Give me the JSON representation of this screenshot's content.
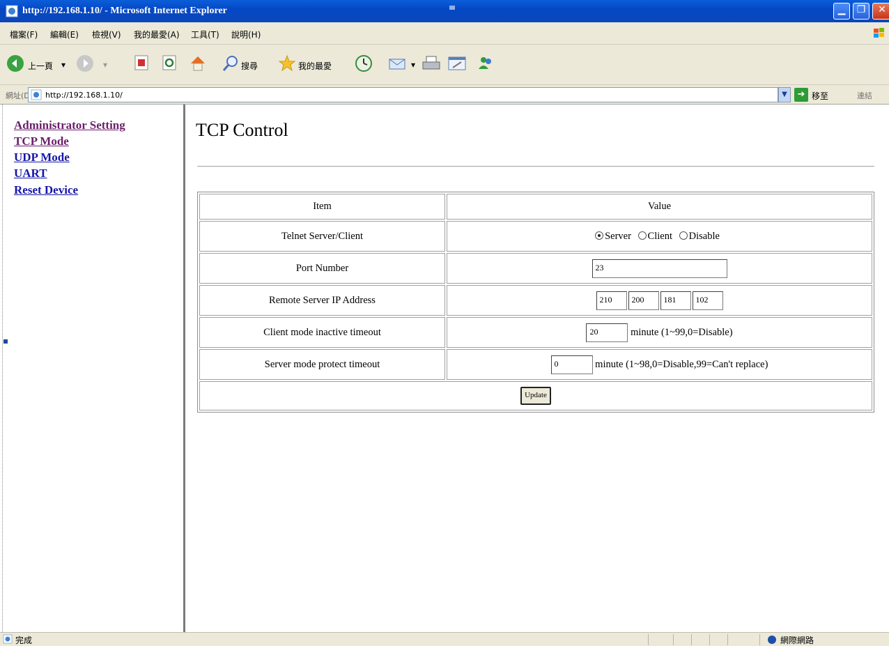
{
  "window": {
    "title": "http://192.168.1.10/ - Microsoft Internet Explorer"
  },
  "menubar": {
    "items": [
      "檔案(F)",
      "編輯(E)",
      "檢視(V)",
      "我的最愛(A)",
      "工具(T)",
      "說明(H)"
    ]
  },
  "toolbar": {
    "back_label": "上一頁",
    "search_label": "搜尋",
    "favorites_label": "我的最愛"
  },
  "addressbar": {
    "label": "網址(D)",
    "url": "http://192.168.1.10/",
    "go_label": "移至",
    "links_label": "連結"
  },
  "nav": {
    "items": [
      "Administrator Setting",
      "TCP Mode",
      "UDP Mode",
      "UART",
      "Reset Device"
    ]
  },
  "main": {
    "title": "TCP Control",
    "table": {
      "header_item": "Item",
      "header_value": "Value",
      "telnet_label": "Telnet Server/Client",
      "telnet_options": [
        "Server",
        "Client",
        "Disable"
      ],
      "telnet_selected": "Server",
      "port_label": "Port Number",
      "port_value": "23",
      "remote_ip_label": "Remote Server IP Address",
      "remote_ip": [
        "210",
        "200",
        "181",
        "102"
      ],
      "client_timeout_label": "Client mode inactive timeout",
      "client_timeout_value": "20",
      "client_timeout_hint": "minute (1~99,0=Disable)",
      "server_timeout_label": "Server mode protect timeout",
      "server_timeout_value": "0",
      "server_timeout_hint": "minute (1~98,0=Disable,99=Can't replace)",
      "update_label": "Update"
    }
  },
  "statusbar": {
    "status_text": "完成",
    "zone_text": "網際網路"
  }
}
